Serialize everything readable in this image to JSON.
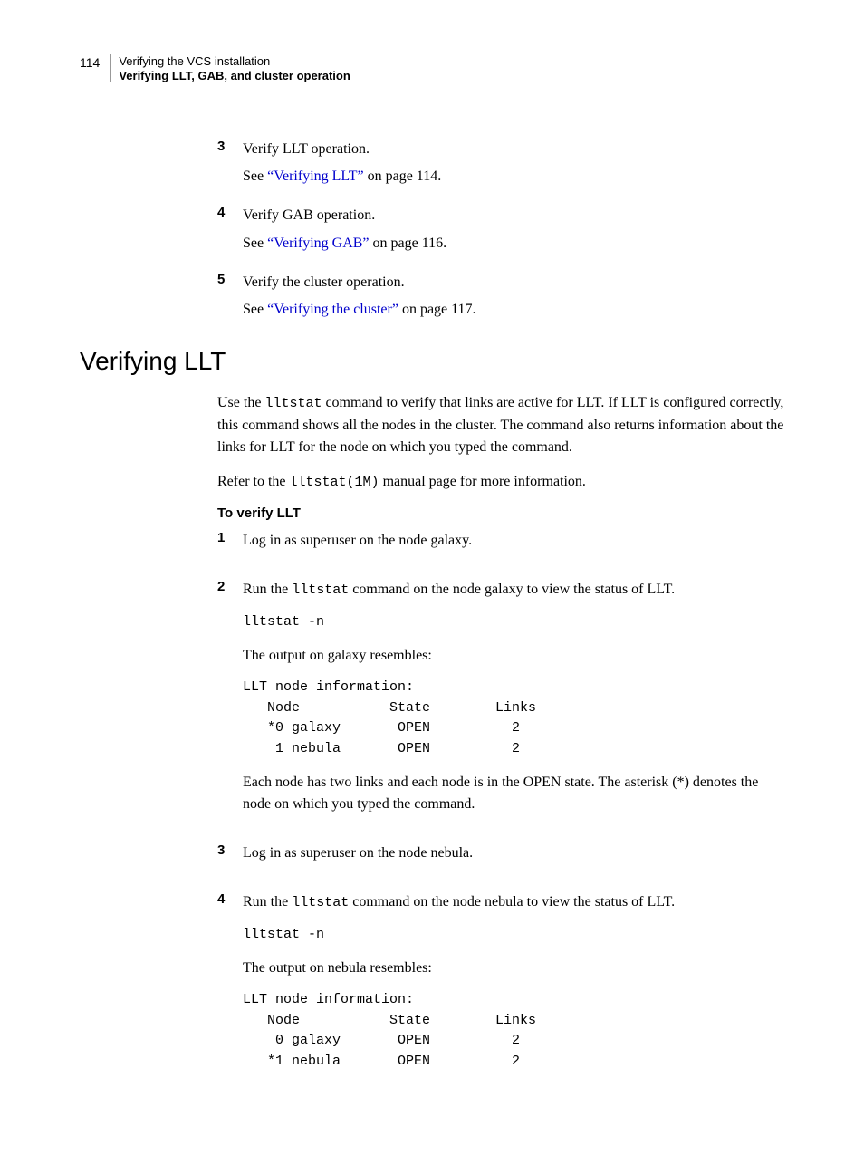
{
  "header": {
    "page_number": "114",
    "chapter": "Verifying the VCS installation",
    "section": "Verifying LLT, GAB, and cluster operation"
  },
  "top_steps": [
    {
      "num": "3",
      "text": "Verify LLT operation.",
      "see_prefix": "See ",
      "see_link": "“Verifying LLT”",
      "see_suffix": " on page 114."
    },
    {
      "num": "4",
      "text": "Verify GAB operation.",
      "see_prefix": "See ",
      "see_link": "“Verifying GAB”",
      "see_suffix": " on page 116."
    },
    {
      "num": "5",
      "text": "Verify the cluster operation.",
      "see_prefix": "See ",
      "see_link": "“Verifying the cluster”",
      "see_suffix": " on page 117."
    }
  ],
  "h2": "Verifying LLT",
  "intro": {
    "p1_a": "Use the ",
    "p1_code": "lltstat",
    "p1_b": " command to verify that links are active for LLT. If LLT is configured correctly, this command shows all the nodes in the cluster. The command also returns information about the links for LLT for the node on which you typed the command.",
    "p2_a": "Refer to the ",
    "p2_code": "lltstat(1M)",
    "p2_b": " manual page for more information."
  },
  "subhead": "To verify LLT",
  "steps": [
    {
      "num": "1",
      "body": [
        {
          "type": "text",
          "value": "Log in as superuser on the node galaxy."
        }
      ]
    },
    {
      "num": "2",
      "body": [
        {
          "type": "mixed",
          "a": "Run the ",
          "code": "lltstat",
          "b": " command on the node galaxy to view the status of LLT."
        },
        {
          "type": "code",
          "value": "lltstat -n"
        },
        {
          "type": "text",
          "value": "The output on galaxy resembles:"
        },
        {
          "type": "code",
          "value": "LLT node information:\n   Node           State        Links\n   *0 galaxy       OPEN          2\n    1 nebula       OPEN          2"
        },
        {
          "type": "text",
          "value": "Each node has two links and each node is in the OPEN state. The asterisk (*) denotes the node on which you typed the command."
        }
      ]
    },
    {
      "num": "3",
      "body": [
        {
          "type": "text",
          "value": "Log in as superuser on the node nebula."
        }
      ]
    },
    {
      "num": "4",
      "body": [
        {
          "type": "mixed",
          "a": "Run the ",
          "code": "lltstat",
          "b": " command on the node nebula to view the status of LLT."
        },
        {
          "type": "code",
          "value": "lltstat -n"
        },
        {
          "type": "text",
          "value": "The output on nebula resembles:"
        },
        {
          "type": "code",
          "value": "LLT node information:\n   Node           State        Links\n    0 galaxy       OPEN          2\n   *1 nebula       OPEN          2"
        }
      ]
    }
  ]
}
